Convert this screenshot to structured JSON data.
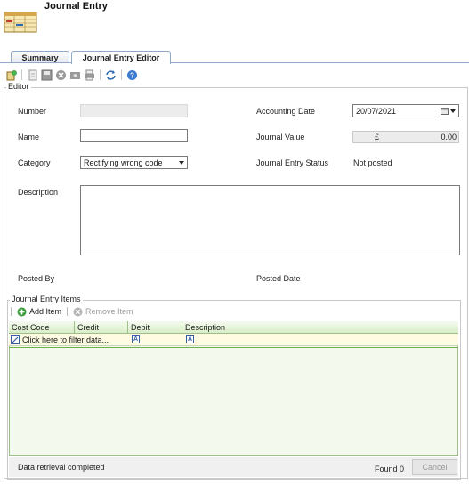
{
  "header": {
    "title": "Journal Entry"
  },
  "tabs": [
    {
      "label": "Summary",
      "active": false
    },
    {
      "label": "Journal Entry Editor",
      "active": true
    }
  ],
  "toolbar": {
    "icons": [
      "new-icon",
      "document-icon",
      "save-icon",
      "delete-icon",
      "camera-icon",
      "print-icon",
      "refresh-icon",
      "help-icon"
    ]
  },
  "editor": {
    "legend": "Editor",
    "number_label": "Number",
    "number_value": "",
    "name_label": "Name",
    "name_value": "",
    "category_label": "Category",
    "category_value": "Rectifying wrong code",
    "description_label": "Description",
    "description_value": "",
    "posted_by_label": "Posted By",
    "accounting_date_label": "Accounting Date",
    "accounting_date_value": "20/07/2021",
    "journal_value_label": "Journal Value",
    "currency_symbol": "£",
    "journal_value": "0.00",
    "status_label": "Journal Entry Status",
    "status_value": "Not posted",
    "posted_date_label": "Posted Date"
  },
  "items": {
    "legend": "Journal Entry Items",
    "add_label": "Add Item",
    "remove_label": "Remove Item",
    "columns": [
      "Cost Code",
      "Credit",
      "Debit",
      "Description"
    ],
    "filter_placeholder": "Click here to filter data...",
    "status_text": "Data retrieval completed",
    "found_text": "Found 0",
    "cancel_label": "Cancel"
  },
  "colors": {
    "grid_border": "#9fbf8a",
    "grid_bg": "#f3f9ec",
    "filter_bg": "#fffbe2",
    "tab_border": "#8fa9c9"
  }
}
